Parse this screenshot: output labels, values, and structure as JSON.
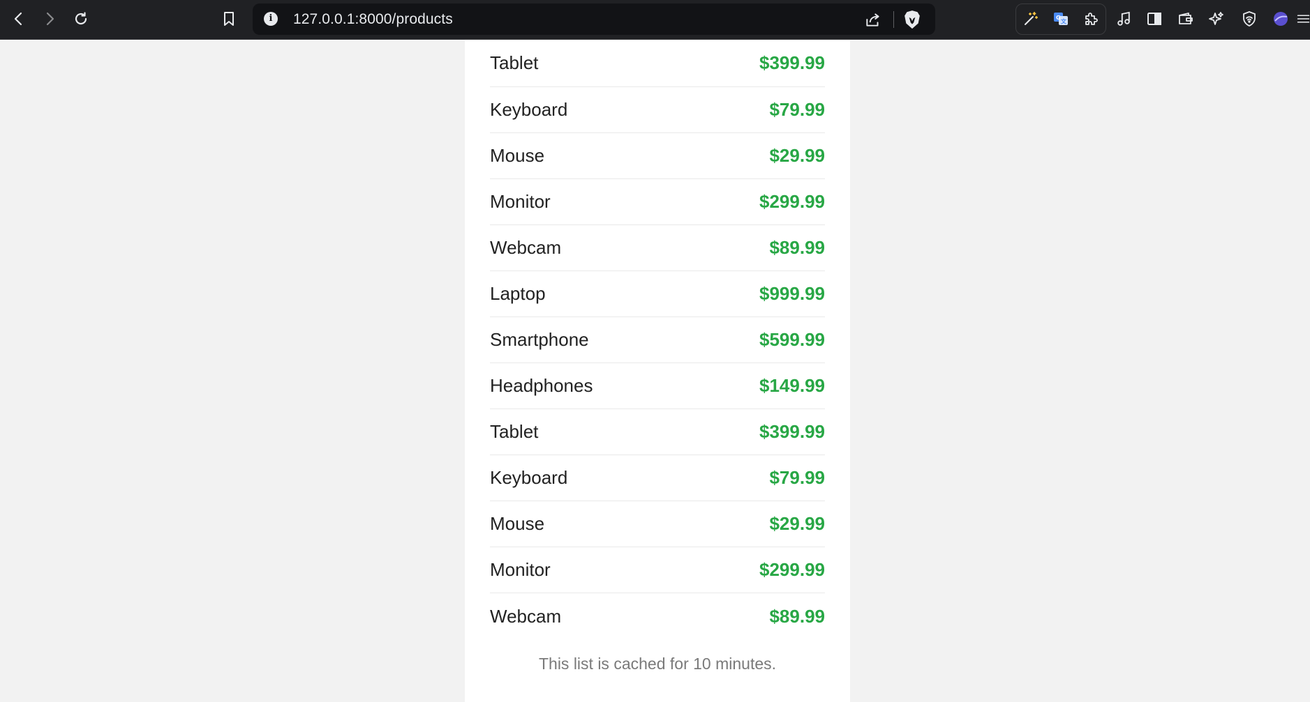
{
  "browser": {
    "url": "127.0.0.1:8000/products"
  },
  "products": [
    {
      "name": "Tablet",
      "price": "$399.99"
    },
    {
      "name": "Keyboard",
      "price": "$79.99"
    },
    {
      "name": "Mouse",
      "price": "$29.99"
    },
    {
      "name": "Monitor",
      "price": "$299.99"
    },
    {
      "name": "Webcam",
      "price": "$89.99"
    },
    {
      "name": "Laptop",
      "price": "$999.99"
    },
    {
      "name": "Smartphone",
      "price": "$599.99"
    },
    {
      "name": "Headphones",
      "price": "$149.99"
    },
    {
      "name": "Tablet",
      "price": "$399.99"
    },
    {
      "name": "Keyboard",
      "price": "$79.99"
    },
    {
      "name": "Mouse",
      "price": "$29.99"
    },
    {
      "name": "Monitor",
      "price": "$299.99"
    },
    {
      "name": "Webcam",
      "price": "$89.99"
    }
  ],
  "footer_note": "This list is cached for 10 minutes.",
  "colors": {
    "price": "#28a745",
    "toolbar": "#202124",
    "page_background": "#f2f2f2",
    "card": "#ffffff"
  }
}
